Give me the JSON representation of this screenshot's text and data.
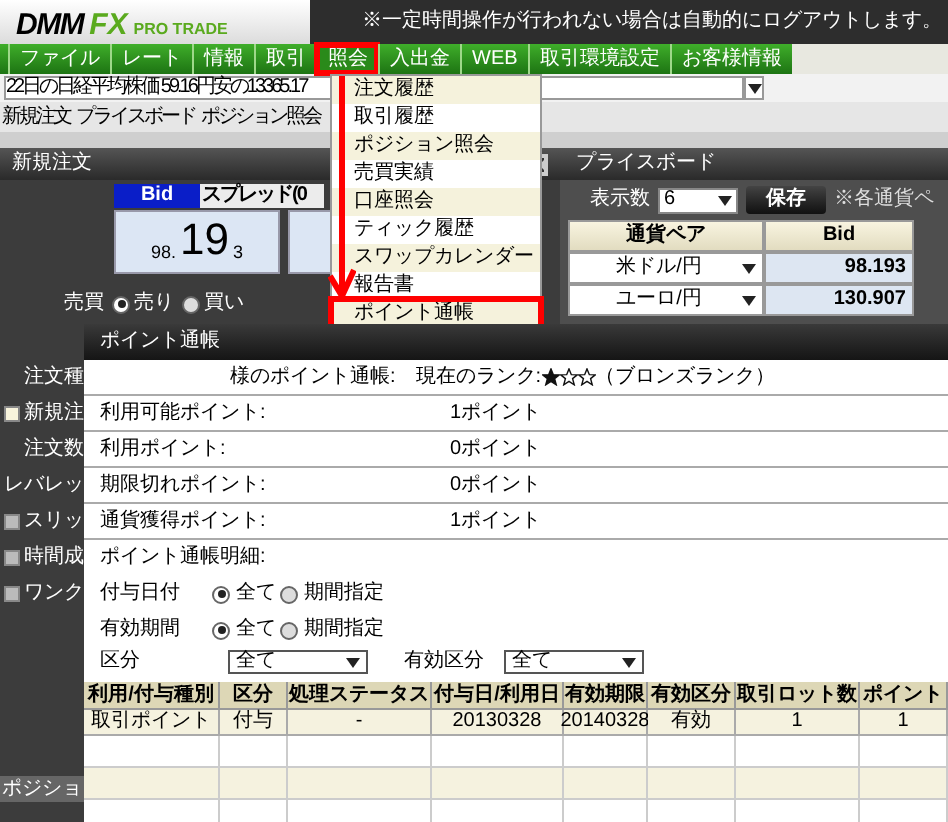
{
  "header": {
    "logo_main": "DMM",
    "logo_fx": "FX",
    "logo_sub": "PRO TRADE",
    "notice": "※一定時間操作が行われない場合は自動的にログアウトします。"
  },
  "menu": [
    {
      "label": "ファイル",
      "selected": false
    },
    {
      "label": "レート",
      "selected": false
    },
    {
      "label": "情報",
      "selected": false
    },
    {
      "label": "取引",
      "selected": false
    },
    {
      "label": "照会",
      "selected": true
    },
    {
      "label": "入出金",
      "selected": false
    },
    {
      "label": "WEB",
      "selected": false
    },
    {
      "label": "取引環境設定",
      "selected": false
    },
    {
      "label": "お客様情報",
      "selected": false
    }
  ],
  "quote_menu": [
    {
      "label": "注文履歴",
      "selected": false
    },
    {
      "label": "取引履歴",
      "selected": false
    },
    {
      "label": "ポジション照会",
      "selected": false
    },
    {
      "label": "売買実績",
      "selected": false
    },
    {
      "label": "口座照会",
      "selected": false
    },
    {
      "label": "ティック履歴",
      "selected": false
    },
    {
      "label": "スワップカレンダー",
      "selected": false
    },
    {
      "label": "報告書",
      "selected": false
    },
    {
      "label": "ポイント通帳",
      "selected": true
    }
  ],
  "ticker": {
    "value": "22日の日経平均株価 59.16円安の13365.17"
  },
  "tabs": [
    "新規注文",
    "プライスボード",
    "ポジション照会"
  ],
  "order_panel": {
    "title": "新規注文",
    "bid_label": "Bid",
    "spread_label": "スプレッド(0",
    "price_head": "98.",
    "price_big": "19",
    "price_tail": "3",
    "side_label": "売買",
    "sides": [
      {
        "label": "売り",
        "selected": true
      },
      {
        "label": "買い",
        "selected": false
      }
    ],
    "fields": [
      {
        "kind": "label",
        "label": "注文種"
      },
      {
        "kind": "checkbox",
        "label": "新規注",
        "checked": false
      },
      {
        "kind": "label",
        "label": "注文数"
      },
      {
        "kind": "label",
        "label": "レバレッ"
      },
      {
        "kind": "checkbox",
        "label": "スリッ",
        "checked": false
      },
      {
        "kind": "checkbox",
        "label": "時間成",
        "checked": false
      },
      {
        "kind": "checkbox",
        "label": "ワンク",
        "checked": false
      }
    ],
    "bottom_tab": "ポジショ"
  },
  "price_board": {
    "title": "プライスボード",
    "count_label": "表示数",
    "count_value": "6",
    "save": "保存",
    "note": "※各通貨ペ",
    "columns": [
      "通貨ペア",
      "Bid"
    ],
    "rows": [
      {
        "pair": "米ドル/円",
        "bid": "98.193"
      },
      {
        "pair": "ユーロ/円",
        "bid": "130.907"
      }
    ]
  },
  "dialog": {
    "title": "ポイント通帳",
    "owner": "様のポイント通帳:",
    "rank_label": "現在のランク:",
    "stars": 1,
    "rank_name": "（ブロンズランク）",
    "summary": [
      {
        "label": "利用可能ポイント:",
        "value": "1ポイント"
      },
      {
        "label": "利用ポイント:",
        "value": "0ポイント"
      },
      {
        "label": "期限切れポイント:",
        "value": "0ポイント"
      },
      {
        "label": "通貨獲得ポイント:",
        "value": "1ポイント"
      }
    ],
    "detail_label": "ポイント通帳明細:",
    "radio_filters": [
      {
        "label": "付与日付",
        "options": [
          {
            "label": "全て",
            "selected": true
          },
          {
            "label": "期間指定",
            "selected": false
          }
        ]
      },
      {
        "label": "有効期間",
        "options": [
          {
            "label": "全て",
            "selected": true
          },
          {
            "label": "期間指定",
            "selected": false
          }
        ]
      }
    ],
    "select_filters": [
      {
        "label": "区分",
        "value": "全て"
      },
      {
        "label": "有効区分",
        "value": "全て"
      }
    ],
    "table": {
      "columns": [
        "利用/付与種別",
        "区分",
        "処理ステータス",
        "付与日/利用日",
        "有効期限",
        "有効区分",
        "取引ロット数",
        "ポイント"
      ],
      "rows": [
        [
          "取引ポイント",
          "付与",
          "-",
          "20130328",
          "20140328",
          "有効",
          "1",
          "1"
        ]
      ]
    }
  }
}
